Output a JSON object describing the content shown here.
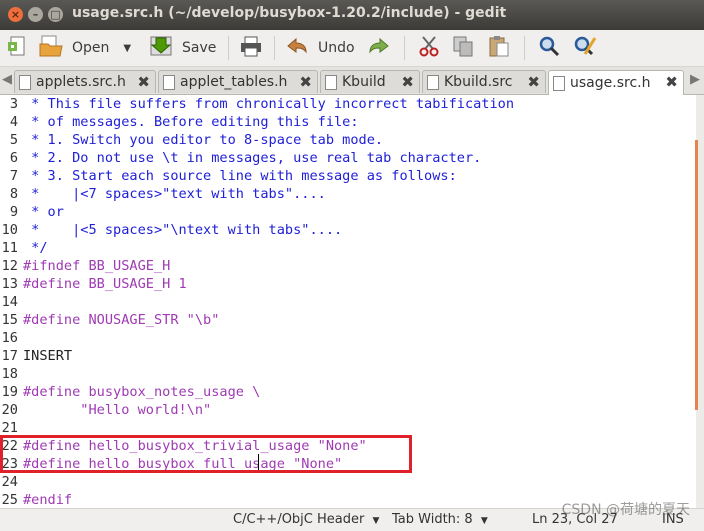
{
  "window": {
    "title": "usage.src.h (~/develop/busybox-1.20.2/include) - gedit"
  },
  "toolbar": {
    "open_label": "Open",
    "save_label": "Save",
    "undo_label": "Undo"
  },
  "tabs": [
    {
      "label": "applets.src.h"
    },
    {
      "label": "applet_tables.h"
    },
    {
      "label": "Kbuild"
    },
    {
      "label": "Kbuild.src"
    },
    {
      "label": "usage.src.h",
      "active": true
    }
  ],
  "editor": {
    "lines": [
      {
        "num": "3",
        "text": " * This file suffers from chronically incorrect tabification",
        "kind": "comment"
      },
      {
        "num": "4",
        "text": " * of messages. Before editing this file:",
        "kind": "comment"
      },
      {
        "num": "5",
        "text": " * 1. Switch you editor to 8-space tab mode.",
        "kind": "comment"
      },
      {
        "num": "6",
        "text": " * 2. Do not use \\t in messages, use real tab character.",
        "kind": "comment"
      },
      {
        "num": "7",
        "text": " * 3. Start each source line with message as follows:",
        "kind": "comment"
      },
      {
        "num": "8",
        "text": " *    |<7 spaces>\"text with tabs\"....",
        "kind": "comment"
      },
      {
        "num": "9",
        "text": " * or",
        "kind": "comment"
      },
      {
        "num": "10",
        "text": " *    |<5 spaces>\"\\ntext with tabs\"....",
        "kind": "comment"
      },
      {
        "num": "11",
        "text": " */",
        "kind": "comment"
      },
      {
        "num": "12",
        "text": "#ifndef BB_USAGE_H",
        "kind": "pre"
      },
      {
        "num": "13",
        "text": "#define BB_USAGE_H 1",
        "kind": "pre"
      },
      {
        "num": "14",
        "text": "",
        "kind": "plain"
      },
      {
        "num": "15",
        "text": "#define NOUSAGE_STR \"\\b\"",
        "kind": "pre"
      },
      {
        "num": "16",
        "text": "",
        "kind": "plain"
      },
      {
        "num": "17",
        "text": "INSERT",
        "kind": "plain"
      },
      {
        "num": "18",
        "text": "",
        "kind": "plain"
      },
      {
        "num": "19",
        "text": "#define busybox_notes_usage \\",
        "kind": "pre"
      },
      {
        "num": "20",
        "text": "       \"Hello world!\\n\"",
        "kind": "pre"
      },
      {
        "num": "21",
        "text": "",
        "kind": "plain"
      },
      {
        "num": "22",
        "text": "#define hello_busybox_trivial_usage \"None\"",
        "kind": "pre"
      },
      {
        "num": "23",
        "text": "#define hello_busybox_full_usage \"None\"",
        "kind": "pre"
      },
      {
        "num": "24",
        "text": "",
        "kind": "plain"
      },
      {
        "num": "25",
        "text": "#endif",
        "kind": "pre"
      }
    ]
  },
  "statusbar": {
    "language": "C/C++/ObjC Header",
    "tab_width": "Tab Width: 8",
    "position": "Ln 23, Col 27",
    "mode": "INS"
  },
  "watermark": "CSDN @荷塘的夏天"
}
